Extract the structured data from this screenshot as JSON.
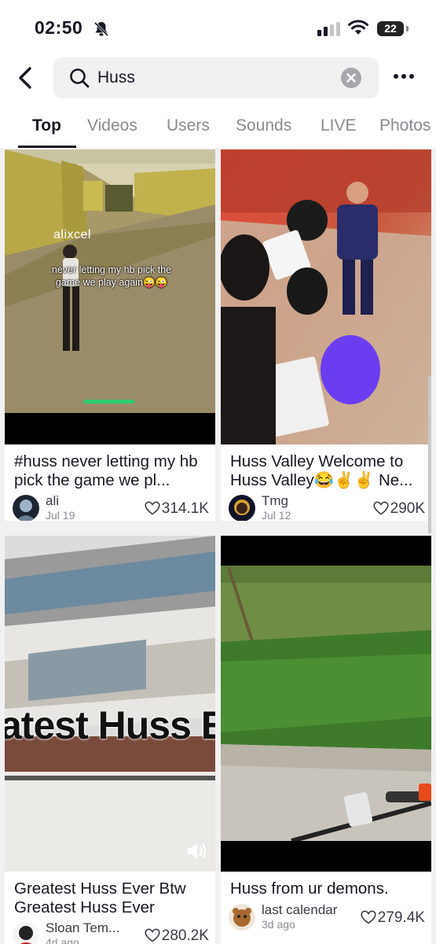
{
  "status_bar": {
    "time": "02:50",
    "battery": "22"
  },
  "search": {
    "query": "Huss"
  },
  "tabs": [
    {
      "label": "Top"
    },
    {
      "label": "Videos"
    },
    {
      "label": "Users"
    },
    {
      "label": "Sounds"
    },
    {
      "label": "LIVE"
    },
    {
      "label": "Photos"
    }
  ],
  "results": [
    {
      "overlay_user": "alixcel",
      "overlay_text": "never letting my hb pick the game we play again😜😜",
      "caption": "#huss never letting my hb pick the game we pl...",
      "author": "ali",
      "date": "Jul 19",
      "likes": "314.1K"
    },
    {
      "caption": "Huss Valley Welcome to Huss Valley😂✌️✌️ Ne...",
      "author": "Tmg",
      "date": "Jul 12",
      "likes": "290K"
    },
    {
      "overlay_text": "atest Huss E",
      "caption": "Greatest Huss Ever Btw Greatest Huss Ever",
      "author": "Sloan Tem...",
      "date": "4d ago",
      "likes": "280.2K"
    },
    {
      "caption": "Huss from ur demons.",
      "author": "last calendar",
      "date": "3d ago",
      "likes": "279.4K"
    }
  ],
  "icons": [
    "bell-off-icon",
    "signal-icon",
    "wifi-icon",
    "battery-icon",
    "back-arrow-icon",
    "search-icon",
    "clear-icon",
    "more-icon",
    "heart-icon",
    "speaker-icon"
  ],
  "colors": {
    "accent": "#161823",
    "muted": "#8a8b91",
    "background": "#f1f1f2"
  }
}
